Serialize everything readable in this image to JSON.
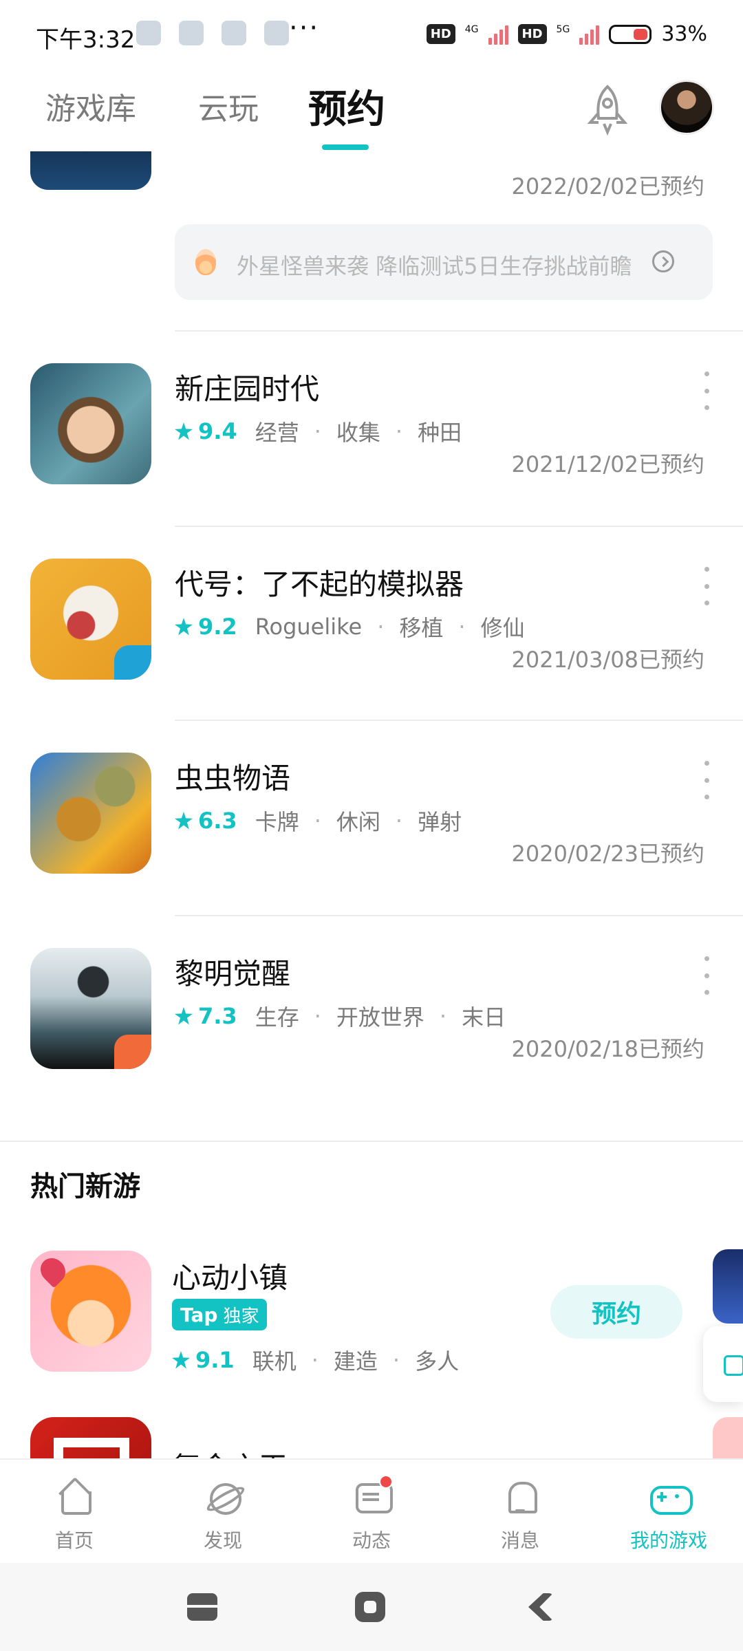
{
  "status_bar": {
    "time": "下午3:32",
    "net1": "4G",
    "net2": "5G",
    "hd": "HD",
    "battery": "33%"
  },
  "top_tabs": {
    "tabs": [
      {
        "label": "游戏库"
      },
      {
        "label": "云玩"
      },
      {
        "label": "预约"
      }
    ],
    "active_index": 2
  },
  "first_item": {
    "reserve_date": "2022/02/02已预约",
    "notice": "外星怪兽来袭 降临测试5日生存挑战前瞻"
  },
  "games": [
    {
      "title": "新庄园时代",
      "score": "9.4",
      "tags": [
        "经营",
        "收集",
        "种田"
      ],
      "reserve_date": "2021/12/02已预约"
    },
    {
      "title": "代号：了不起的模拟器",
      "score": "9.2",
      "tags": [
        "Roguelike",
        "移植",
        "修仙"
      ],
      "reserve_date": "2021/03/08已预约"
    },
    {
      "title": "虫虫物语",
      "score": "6.3",
      "tags": [
        "卡牌",
        "休闲",
        "弹射"
      ],
      "reserve_date": "2020/02/23已预约"
    },
    {
      "title": "黎明觉醒",
      "score": "7.3",
      "tags": [
        "生存",
        "开放世界",
        "末日"
      ],
      "reserve_date": "2020/02/18已预约"
    }
  ],
  "hot_section": {
    "title": "热门新游",
    "items": [
      {
        "title": "心动小镇",
        "badge_tap": "Tap",
        "badge_exclusive": "独家",
        "score": "9.1",
        "tags": [
          "联机",
          "建造",
          "多人"
        ],
        "button": "预约"
      },
      {
        "title": "氪金之王"
      }
    ]
  },
  "bottom_nav": [
    {
      "label": "首页",
      "icon": "home-icon"
    },
    {
      "label": "发现",
      "icon": "discover-icon"
    },
    {
      "label": "动态",
      "icon": "chat-icon"
    },
    {
      "label": "消息",
      "icon": "bell-icon"
    },
    {
      "label": "我的游戏",
      "icon": "gamepad-icon"
    }
  ],
  "colors": {
    "accent": "#13c2c2",
    "text": "#111111",
    "secondary": "#8a8a8a"
  }
}
